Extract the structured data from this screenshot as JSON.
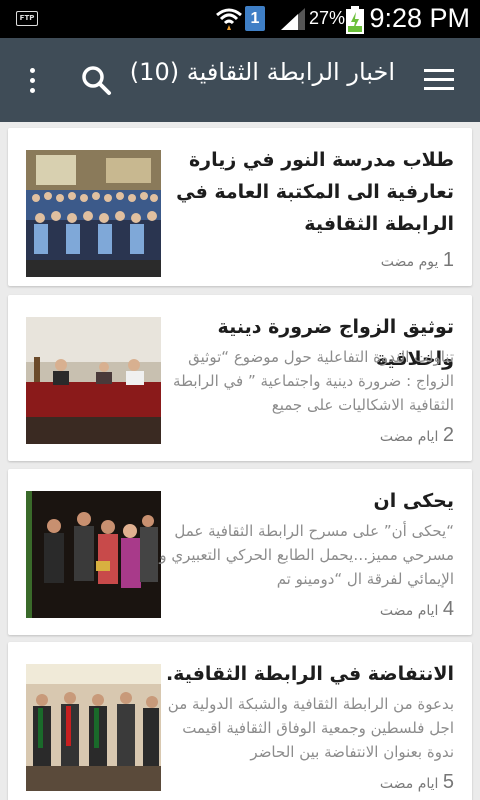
{
  "status_bar": {
    "ftp_label": "FTP",
    "sim_slot": "1",
    "battery_percent": "27%",
    "time": "9:28 PM"
  },
  "app_bar": {
    "title": "اخبار الرابطة الثقافية (10)",
    "icons": {
      "overflow": "more-vert-icon",
      "search": "search-icon",
      "menu": "hamburger-menu-icon"
    }
  },
  "articles": [
    {
      "title": "طلاب مدرسة النور في زيارة تعارفية الى المكتبة العامة في الرابطة الثقافية",
      "excerpt": "",
      "time_number": "1",
      "time_unit": "يوم مضت"
    },
    {
      "title": "توثيق الزواج ضرورة دينية واخلاقية",
      "excerpt": "تناولت الندوة التفاعلية حول موضوع “توثيق الزواج : ضرورة دينية واجتماعية ” في الرابطة الثقافية الاشكاليات على جميع",
      "time_number": "2",
      "time_unit": "ايام مضت"
    },
    {
      "title": "يحكى ان",
      "excerpt": "“يحكى أن” على مسرح الرابطة الثقافية عمل مسرحي مميز…يحمل الطابع الحركي التعبيري و الإيمائي لفرقة ال “دومينو تم",
      "time_number": "4",
      "time_unit": "ايام مضت"
    },
    {
      "title": "الانتفاضة في الرابطة الثقافية.",
      "excerpt": "بدعوة من الرابطة الثقافية والشبكة الدولية من اجل فلسطين وجمعية الوفاق الثقافية اقيمت ندوة بعنوان الانتفاضة بين الحاضر",
      "time_number": "5",
      "time_unit": "ايام مضت"
    }
  ],
  "colors": {
    "app_bar": "#3f4c57",
    "background": "#ebebeb",
    "card": "#ffffff",
    "title_text": "#1d1d1d",
    "excerpt_text": "#8c8c8c"
  }
}
